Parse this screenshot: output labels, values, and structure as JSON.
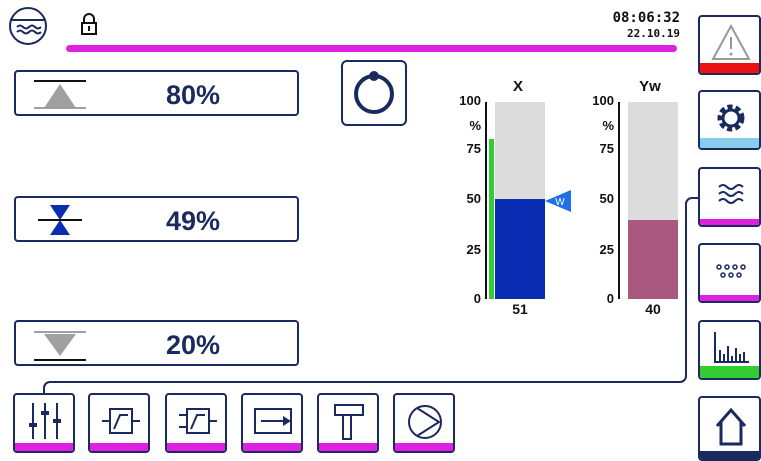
{
  "header": {
    "time": "08:06:32",
    "date": "22.10.19",
    "accent_color": "#e020e0"
  },
  "setpoints": {
    "upper": {
      "value": "80%",
      "icon": "upper-limit-icon"
    },
    "middle": {
      "value": "49%",
      "icon": "hourglass-valve-icon"
    },
    "lower": {
      "value": "20%",
      "icon": "lower-limit-icon"
    }
  },
  "bar_x": {
    "label": "X",
    "unit": "%",
    "ticks": [
      "100",
      "75",
      "50",
      "25",
      "0"
    ],
    "value": 51,
    "value_label": "51",
    "setpoint_marker": "W",
    "fill_color": "#0a2db4",
    "bg_color": "#dcdcdc"
  },
  "bar_yw": {
    "label": "Yw",
    "unit": "%",
    "ticks": [
      "100",
      "75",
      "50",
      "25",
      "0"
    ],
    "value": 40,
    "value_label": "40",
    "fill_color": "#a9597e",
    "bg_color": "#dcdcdc"
  },
  "right_nav": [
    {
      "name": "alarm",
      "icon": "warning-icon",
      "stripe": "#ee1111"
    },
    {
      "name": "settings",
      "icon": "gear-icon",
      "stripe": "#88ccee"
    },
    {
      "name": "process",
      "icon": "water-waves-icon",
      "stripe": "#e020e0"
    },
    {
      "name": "parameters",
      "icon": "dots-grid-icon",
      "stripe": "#e020e0"
    },
    {
      "name": "trend",
      "icon": "bar-chart-icon",
      "stripe": "#33cc33"
    },
    {
      "name": "home",
      "icon": "home-icon",
      "stripe": "#1a2a5e"
    }
  ],
  "bottom_toolbar": [
    {
      "name": "mixer",
      "icon": "sliders-icon"
    },
    {
      "name": "controller-a",
      "icon": "controller-block-icon"
    },
    {
      "name": "controller-b",
      "icon": "controller-block-2-icon"
    },
    {
      "name": "output",
      "icon": "arrow-box-icon"
    },
    {
      "name": "valve",
      "icon": "valve-stem-icon"
    },
    {
      "name": "pump",
      "icon": "pump-icon"
    }
  ]
}
